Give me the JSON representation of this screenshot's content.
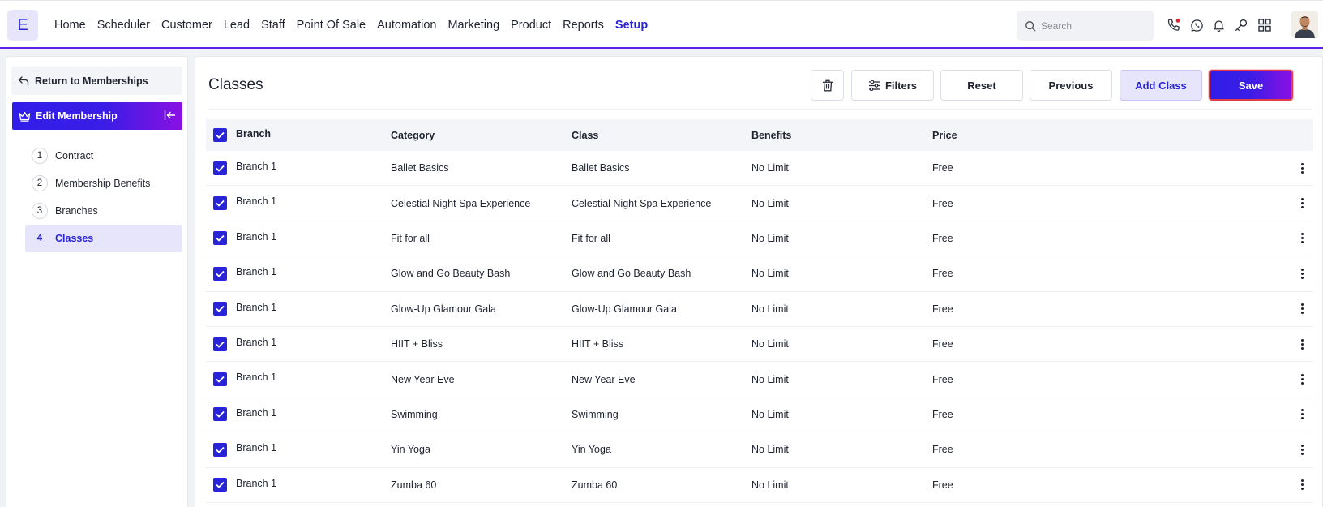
{
  "app": {
    "logo_letter": "E"
  },
  "nav": {
    "items": [
      {
        "label": "Home",
        "active": false
      },
      {
        "label": "Scheduler",
        "active": false
      },
      {
        "label": "Customer",
        "active": false
      },
      {
        "label": "Lead",
        "active": false
      },
      {
        "label": "Staff",
        "active": false
      },
      {
        "label": "Point Of Sale",
        "active": false
      },
      {
        "label": "Automation",
        "active": false
      },
      {
        "label": "Marketing",
        "active": false
      },
      {
        "label": "Product",
        "active": false
      },
      {
        "label": "Reports",
        "active": false
      },
      {
        "label": "Setup",
        "active": true
      }
    ],
    "search_placeholder": "Search",
    "icons": [
      "phone-icon",
      "whatsapp-icon",
      "bell-icon",
      "key-icon",
      "grid-icon"
    ],
    "notification_dot_color": "#e0242e"
  },
  "sidebar": {
    "return_label": "Return to Memberships",
    "section_label": "Edit Membership",
    "steps": [
      {
        "num": "1",
        "label": "Contract",
        "active": false
      },
      {
        "num": "2",
        "label": "Membership Benefits",
        "active": false
      },
      {
        "num": "3",
        "label": "Branches",
        "active": false
      },
      {
        "num": "4",
        "label": "Classes",
        "active": true
      }
    ]
  },
  "main": {
    "title": "Classes",
    "buttons": {
      "delete_icon": "trash-icon",
      "filters": "Filters",
      "reset": "Reset",
      "previous": "Previous",
      "add_class": "Add Class",
      "save": "Save"
    },
    "table": {
      "headers": {
        "branch": "Branch",
        "category": "Category",
        "class": "Class",
        "benefits": "Benefits",
        "price": "Price"
      },
      "rows": [
        {
          "branch": "Branch 1",
          "category": "Ballet Basics",
          "class": "Ballet Basics",
          "benefits": "No Limit",
          "price": "Free",
          "checked": true
        },
        {
          "branch": "Branch 1",
          "category": "Celestial Night Spa Experience",
          "class": "Celestial Night Spa Experience",
          "benefits": "No Limit",
          "price": "Free",
          "checked": true
        },
        {
          "branch": "Branch 1",
          "category": "Fit for all",
          "class": "Fit for all",
          "benefits": "No Limit",
          "price": "Free",
          "checked": true
        },
        {
          "branch": "Branch 1",
          "category": "Glow and Go Beauty Bash",
          "class": "Glow and Go Beauty Bash",
          "benefits": "No Limit",
          "price": "Free",
          "checked": true
        },
        {
          "branch": "Branch 1",
          "category": "Glow-Up Glamour Gala",
          "class": "Glow-Up Glamour Gala",
          "benefits": "No Limit",
          "price": "Free",
          "checked": true
        },
        {
          "branch": "Branch 1",
          "category": "HIIT + Bliss",
          "class": "HIIT + Bliss",
          "benefits": "No Limit",
          "price": "Free",
          "checked": true
        },
        {
          "branch": "Branch 1",
          "category": "New Year Eve",
          "class": "New Year Eve",
          "benefits": "No Limit",
          "price": "Free",
          "checked": true
        },
        {
          "branch": "Branch 1",
          "category": "Swimming",
          "class": "Swimming",
          "benefits": "No Limit",
          "price": "Free",
          "checked": true
        },
        {
          "branch": "Branch 1",
          "category": "Yin Yoga",
          "class": "Yin Yoga",
          "benefits": "No Limit",
          "price": "Free",
          "checked": true
        },
        {
          "branch": "Branch 1",
          "category": "Zumba 60",
          "class": "Zumba 60",
          "benefits": "No Limit",
          "price": "Free",
          "checked": true
        }
      ]
    }
  },
  "colors": {
    "accent": "#2a24d9",
    "accent_light": "#e6e5fb",
    "save_border": "#e23c45"
  }
}
